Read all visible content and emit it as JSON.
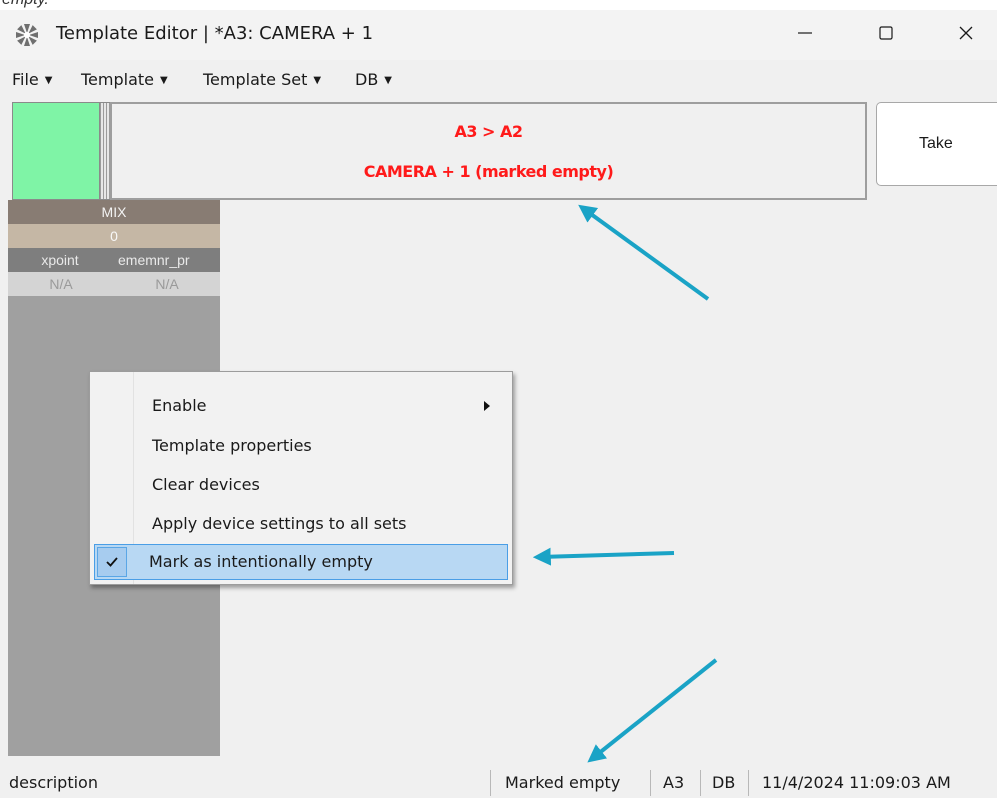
{
  "top_caption": "empty.",
  "window": {
    "title": "Template Editor | *A3: CAMERA + 1"
  },
  "menubar": {
    "items": [
      {
        "label": "File"
      },
      {
        "label": "Template"
      },
      {
        "label": "Template Set"
      },
      {
        "label": "DB"
      }
    ]
  },
  "header": {
    "status_color": "#7ff4a6",
    "route": "A3 > A2",
    "status_text": "CAMERA + 1 (marked empty)",
    "text_color": "#ff1a1a",
    "take_label": "Take"
  },
  "device_panel": {
    "title": "MIX",
    "value": "0",
    "columns": [
      "xpoint",
      "ememnr_pr"
    ],
    "values": [
      "N/A",
      "N/A"
    ]
  },
  "context_menu": {
    "items": [
      {
        "label": "Enable",
        "submenu": true
      },
      {
        "label": "Template properties"
      },
      {
        "label": "Clear devices"
      },
      {
        "label": "Apply device settings to all sets"
      },
      {
        "label": "Mark as intentionally empty",
        "checked": true
      }
    ]
  },
  "statusbar": {
    "description": "description",
    "state": "Marked empty",
    "template": "A3",
    "db": "DB",
    "timestamp": "11/4/2024 11:09:03 AM"
  },
  "annotation_color": "#1aa3c6"
}
